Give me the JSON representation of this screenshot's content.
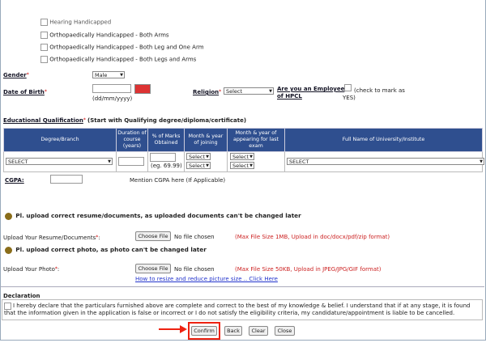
{
  "disability_options": [
    "Hearing Handicapped",
    "Orthopaedically Handicapped - Both Arms",
    "Orthopaedically Handicapped - Both Leg and One Arm",
    "Orthopaedically Handicapped - Both Legs and Arms"
  ],
  "gender": {
    "label": "Gender",
    "value": "Male"
  },
  "dob": {
    "label": "Date of Birth",
    "hint": "(dd/mm/yyyy)"
  },
  "religion": {
    "label": "Religion",
    "value": "Select"
  },
  "employee": {
    "label": "Are you an Employee of HPCL",
    "hint": "(check to mark as YES)"
  },
  "education": {
    "title": "Educational Qualification",
    "subtitle": "(Start with Qualifying degree/diploma/certificate)",
    "headers": [
      "Degree/Branch",
      "Duration of course (years)",
      "% of Marks Obtained",
      "Month & year of joining",
      "Month & year of appearing for last exam",
      "Full Name of University/Institute"
    ],
    "degree_value": "SELECT",
    "marks_hint": "(eg. 69.99)",
    "month_select": "Select",
    "university_value": "SELECT"
  },
  "cgpa": {
    "label": "CGPA:",
    "hint": "Mention CGPA here (If Applicable)"
  },
  "resume_notice": "Pl. upload correct resume/documents, as uploaded documents can't be changed later",
  "resume_upload": {
    "label": "Upload Your Resume/Documents",
    "button": "Choose File",
    "status": "No file chosen",
    "note": "(Max File Size 1MB, Upload in doc/docx/pdf/zip format)"
  },
  "photo_notice": "Pl. upload correct photo, as photo can't be changed later",
  "photo_upload": {
    "label": "Upload Your Photo",
    "button": "Choose File",
    "status": "No file chosen",
    "note": "(Max File Size 50KB, Upload in JPEG/JPG/GIF format)"
  },
  "photo_link": "How to resize and reduce picture size .. Click Here",
  "declaration": {
    "title": "Declaration",
    "text": "I hereby declare that the particulars furnished above are complete and correct to the best of my knowledge & belief. I understand that if at any stage, it is found that the information given in the application is false or incorrect or I do not satisfy the eligibility criteria, my candidature/appointment is liable to be cancelled."
  },
  "buttons": {
    "confirm": "Confirm",
    "back": "Back",
    "clear": "Clear",
    "close": "Close"
  },
  "colors": {
    "table_header": "#2f4f8f",
    "required": "#cc0000",
    "note_red": "#cc2222",
    "highlight": "#e21111"
  }
}
